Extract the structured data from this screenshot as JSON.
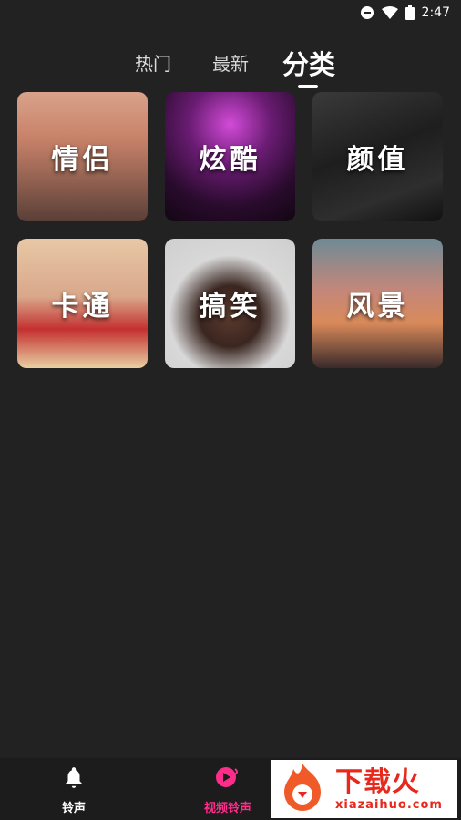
{
  "status": {
    "time": "2:47"
  },
  "tabs": [
    {
      "label": "热门"
    },
    {
      "label": "最新"
    },
    {
      "label": "分类"
    }
  ],
  "categories": [
    {
      "label": "情侣"
    },
    {
      "label": "炫酷"
    },
    {
      "label": "颜值"
    },
    {
      "label": "卡通"
    },
    {
      "label": "搞笑"
    },
    {
      "label": "风景"
    }
  ],
  "bottom_nav": {
    "items": [
      {
        "label": "铃声",
        "icon": "bell-icon",
        "color": "#ffffff"
      },
      {
        "label": "视频铃声",
        "icon": "video-ringtone-icon",
        "color": "#ff2d8a"
      }
    ]
  },
  "ad": {
    "title": "下载火",
    "url": "xiazaihuo.com",
    "brand_color": "#e8281c"
  }
}
